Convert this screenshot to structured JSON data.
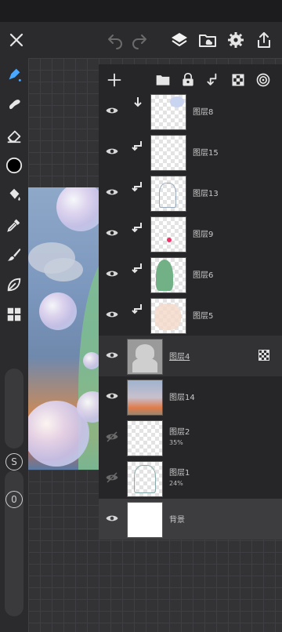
{
  "toolbar": {
    "close_icon": "close-icon",
    "undo_icon": "undo-icon",
    "redo_icon": "redo-icon",
    "layers_icon": "layers-icon",
    "import_icon": "folder-cloud-icon",
    "settings_icon": "gear-icon",
    "share_icon": "share-icon"
  },
  "tools": [
    {
      "name": "pen",
      "icon": "pen-icon",
      "active": true
    },
    {
      "name": "smudge",
      "icon": "smudge-icon"
    },
    {
      "name": "eraser",
      "icon": "eraser-icon"
    },
    {
      "name": "color",
      "icon": "color-swatch-icon"
    },
    {
      "name": "fill",
      "icon": "bucket-icon"
    },
    {
      "name": "eyedropper",
      "icon": "eyedropper-icon"
    },
    {
      "name": "brush",
      "icon": "brush-icon"
    },
    {
      "name": "leaf",
      "icon": "leaf-icon"
    },
    {
      "name": "modules",
      "icon": "grid-icon"
    }
  ],
  "side_buttons": {
    "s_label": "S",
    "o_label": "0"
  },
  "layers_panel": {
    "toolbar_icons": [
      "plus-icon",
      "folder-icon",
      "lock-icon",
      "merge-down-icon",
      "checkerboard-icon",
      "target-icon"
    ],
    "layers": [
      {
        "name": "图层8",
        "clipped": true,
        "opacity": "",
        "selected": false
      },
      {
        "name": "图层15",
        "clipped": true,
        "opacity": "",
        "selected": false
      },
      {
        "name": "图层13",
        "clipped": true,
        "opacity": "",
        "selected": false
      },
      {
        "name": "图层9",
        "clipped": true,
        "opacity": "",
        "selected": false
      },
      {
        "name": "图层6",
        "clipped": true,
        "opacity": "",
        "selected": false
      },
      {
        "name": "图层5",
        "clipped": true,
        "opacity": "",
        "selected": false
      },
      {
        "name": "图层4",
        "clipped": false,
        "opacity": "",
        "selected": true
      },
      {
        "name": "图层14",
        "clipped": false,
        "opacity": "",
        "selected": false
      },
      {
        "name": "图层2",
        "clipped": false,
        "opacity": "35%",
        "selected": false,
        "hidden": true
      },
      {
        "name": "图层1",
        "clipped": false,
        "opacity": "24%",
        "selected": false,
        "hidden": true
      },
      {
        "name": "背景",
        "clipped": false,
        "opacity": "",
        "selected": false,
        "background": true
      }
    ]
  },
  "colors": {
    "accent": "#4aa8ff",
    "panel": "#262628",
    "toolbar": "#2b2b2d"
  }
}
